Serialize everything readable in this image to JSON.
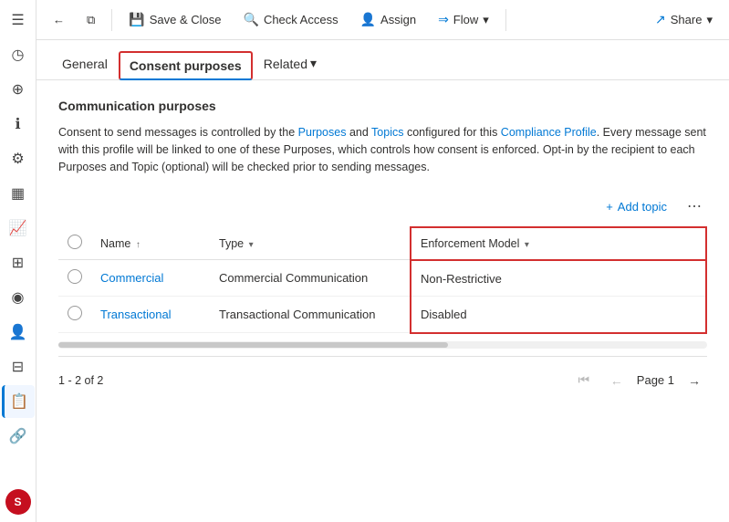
{
  "sidebar": {
    "items": [
      {
        "label": "☰",
        "name": "menu-icon"
      },
      {
        "label": "◷",
        "name": "recent-icon"
      },
      {
        "label": "📌",
        "name": "pin-icon"
      },
      {
        "label": "ℹ",
        "name": "info-icon"
      },
      {
        "label": "⚙",
        "name": "settings-icon"
      },
      {
        "label": "📋",
        "name": "clipboard-icon"
      },
      {
        "label": "📈",
        "name": "chart-icon"
      },
      {
        "label": "⊞",
        "name": "grid-icon"
      },
      {
        "label": "◉",
        "name": "record-icon"
      },
      {
        "label": "👥",
        "name": "people-icon"
      },
      {
        "label": "⊟",
        "name": "list-icon"
      },
      {
        "label": "📝",
        "name": "notes-icon"
      },
      {
        "label": "🔗",
        "name": "link-icon"
      }
    ],
    "user_avatar": "S",
    "user_color": "#c50f1f"
  },
  "toolbar": {
    "back_label": "←",
    "restore_label": "⧉",
    "save_close_label": "Save & Close",
    "check_access_label": "Check Access",
    "assign_label": "Assign",
    "flow_label": "Flow",
    "flow_dropdown": "▾",
    "share_label": "Share",
    "share_dropdown": "▾"
  },
  "tabs": {
    "items": [
      {
        "label": "General",
        "name": "tab-general",
        "active": false
      },
      {
        "label": "Consent purposes",
        "name": "tab-consent-purposes",
        "active": true
      },
      {
        "label": "Related",
        "name": "tab-related",
        "active": false
      }
    ],
    "related_dropdown": "▾"
  },
  "content": {
    "section_title": "Communication purposes",
    "description_parts": [
      "Consent to send messages is controlled by the Purposes and Topics configured for this Compliance Profile. Every message sent with this profile will be linked to one of these Purposes, which controls how consent is enforced. Opt-in by the recipient to each Purposes and Topic (optional) will be checked prior to sending messages."
    ],
    "add_topic_label": "Add topic",
    "more_options_label": "⋯",
    "table": {
      "columns": [
        {
          "label": "",
          "name": "col-checkbox"
        },
        {
          "label": "Name",
          "sort": "↑",
          "name": "col-name"
        },
        {
          "label": "Type",
          "sort": "▾",
          "name": "col-type"
        },
        {
          "label": "Enforcement Model",
          "sort": "▾",
          "name": "col-enforcement",
          "highlighted": true
        }
      ],
      "rows": [
        {
          "name": "Commercial",
          "type": "Commercial Communication",
          "enforcement_model": "Non-Restrictive"
        },
        {
          "name": "Transactional",
          "type": "Transactional Communication",
          "enforcement_model": "Disabled"
        }
      ]
    },
    "pagination": {
      "range_start": "1",
      "range_end": "2",
      "total": "2",
      "page_label": "Page 1",
      "first_icon": "⏮",
      "prev_icon": "←",
      "next_icon": "→"
    }
  }
}
